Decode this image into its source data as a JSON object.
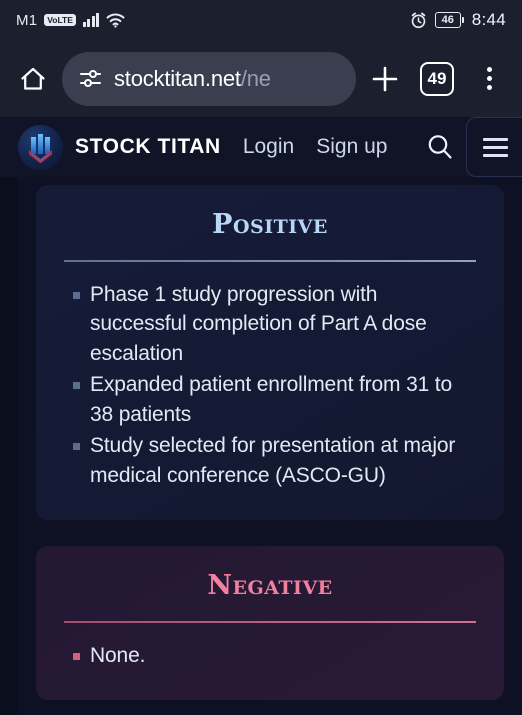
{
  "status_bar": {
    "carrier": "M1",
    "volte_badge": "VoLTE",
    "battery_percent": "46",
    "time": "8:44",
    "icons": [
      "signal-bars-icon",
      "wifi-icon",
      "alarm-clock-icon",
      "battery-icon"
    ]
  },
  "browser": {
    "home_icon": "home-icon",
    "site_settings_icon": "tune-sliders-icon",
    "url_host": "stocktitan.net",
    "url_path": "/ne",
    "url_full": "stocktitan.net/ne",
    "new_tab_icon": "plus-icon",
    "tab_count": "49",
    "menu_icon": "kebab-menu-icon"
  },
  "site_header": {
    "logo_icon": "stock-titan-logo-icon",
    "brand": "STOCK TITAN",
    "login_label": "Login",
    "signup_label": "Sign up",
    "search_icon": "search-icon",
    "hamburger_icon": "hamburger-menu-icon"
  },
  "content": {
    "cards": [
      {
        "id": "positive",
        "title": "Positive",
        "accent": "#b8d7f5",
        "bullets": [
          "Phase 1 study progression with successful completion of Part A dose escalation",
          "Expanded patient enrollment from 31 to 38 patients",
          "Study selected for presentation at major medical conference (ASCO-GU)"
        ]
      },
      {
        "id": "negative",
        "title": "Negative",
        "accent": "#f2809f",
        "bullets": [
          "None."
        ]
      }
    ]
  }
}
